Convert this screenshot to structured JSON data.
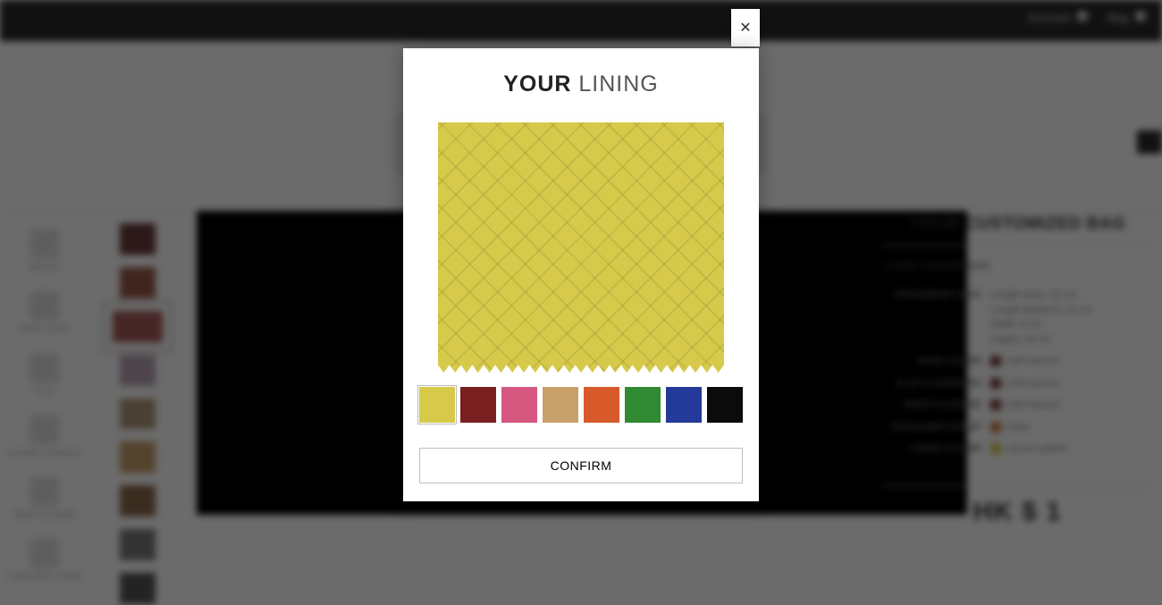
{
  "topbar": {
    "account_label": "Account",
    "bag_label": "Bag"
  },
  "sidebar": {
    "items": [
      {
        "label": "MODELS"
      },
      {
        "label": "MAIN COLOR"
      },
      {
        "label": "FLAP"
      },
      {
        "label": "CLASSIC HANDLES"
      },
      {
        "label": "SNAP CLOSURE"
      },
      {
        "label": "SHOULDER STRAP"
      }
    ]
  },
  "summary": {
    "title": "YOUR CUSTOMIZED BAG",
    "compartment": "1 main compartment",
    "rows": [
      {
        "label": "CROSSBODY BAG",
        "value": "Length base: 22 cm\nLength (bottom): 24 cm\nWidth: 9 cm\nHeight: 16 cm"
      },
      {
        "label": "MAIN COLOR",
        "value": "Soft maroon",
        "sw": "#7a3b38"
      },
      {
        "label": "FLAP & HANDLES",
        "value": "Soft maroon",
        "sw": "#7a3b38"
      },
      {
        "label": "SNAP CLOSURE",
        "value": "Soft maroon",
        "sw": "#7a3b38"
      },
      {
        "label": "SHOULDER STRAP",
        "value": "None",
        "sw": "#cf7a3a"
      },
      {
        "label": "LINING COLOR",
        "value": "Lemon yellow",
        "sw": "#d7c94a"
      }
    ],
    "price": "HK $ 1"
  },
  "modal": {
    "title_bold": "YOUR",
    "title_light": "LINING",
    "selected_color": "#d7c94a",
    "colors": [
      {
        "name": "lemon-yellow",
        "hex": "#d7c94a",
        "selected": true
      },
      {
        "name": "dark-red",
        "hex": "#7a1f1f"
      },
      {
        "name": "pink",
        "hex": "#d6577f"
      },
      {
        "name": "beige",
        "hex": "#c7a06a"
      },
      {
        "name": "orange",
        "hex": "#d85a2a"
      },
      {
        "name": "green",
        "hex": "#2f8a33"
      },
      {
        "name": "blue",
        "hex": "#243a9a"
      },
      {
        "name": "black",
        "hex": "#0b0b0b"
      }
    ],
    "confirm_label": "CONFIRM",
    "close_glyph": "✕"
  },
  "left_swatches": [
    "#6a3a3a",
    "#9a5a4a",
    "#a85a5a",
    "#b9a5b5",
    "#b09a7a",
    "#c7a06a",
    "#8a6a4a",
    "#7a7a7a",
    "#555555"
  ]
}
